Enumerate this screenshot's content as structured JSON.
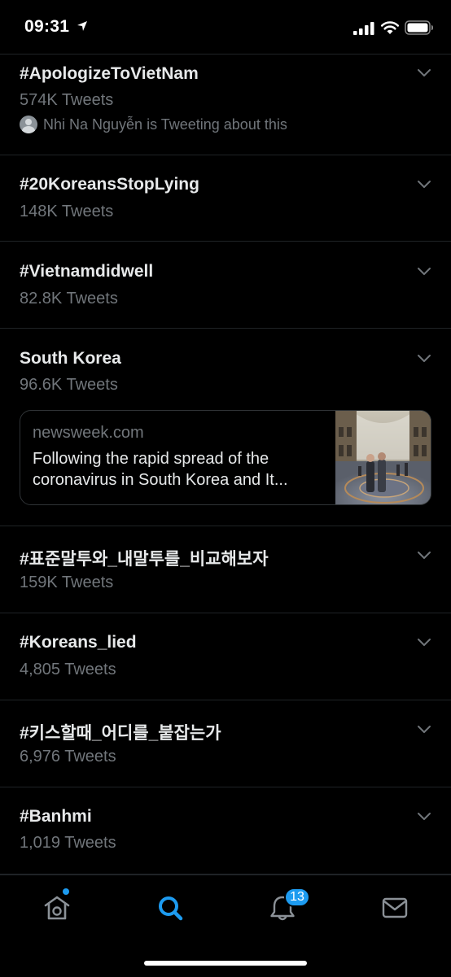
{
  "status": {
    "time": "09:31"
  },
  "trends": [
    {
      "title": "#ApologizeToVietNam",
      "count": "574K Tweets",
      "tweeting": "Nhi Na Nguyễn is Tweeting about this"
    },
    {
      "title": "#20KoreansStopLying",
      "count": "148K Tweets"
    },
    {
      "title": "#Vietnamdidwell",
      "count": "82.8K Tweets"
    },
    {
      "title": "South Korea",
      "count": "96.6K Tweets",
      "card": {
        "source": "newsweek.com",
        "line1": "Following the rapid spread of the",
        "line2": "coronavirus in South Korea and It..."
      }
    },
    {
      "title": "#표준말투와_내말투를_비교해보자",
      "count": "159K Tweets"
    },
    {
      "title": "#Koreans_lied",
      "count": "4,805 Tweets"
    },
    {
      "title": "#키스할때_어디를_붙잡는가",
      "count": "6,976 Tweets"
    },
    {
      "title": "#Banhmi",
      "count": "1,019 Tweets"
    }
  ],
  "tab_bar": {
    "tabs": [
      "home-icon",
      "search-icon",
      "notifications-icon",
      "messages-icon"
    ],
    "active": "search",
    "notification_count": "13"
  },
  "colors": {
    "accent": "#1d9bf0",
    "background": "#000000",
    "secondary_text": "#71767b"
  }
}
